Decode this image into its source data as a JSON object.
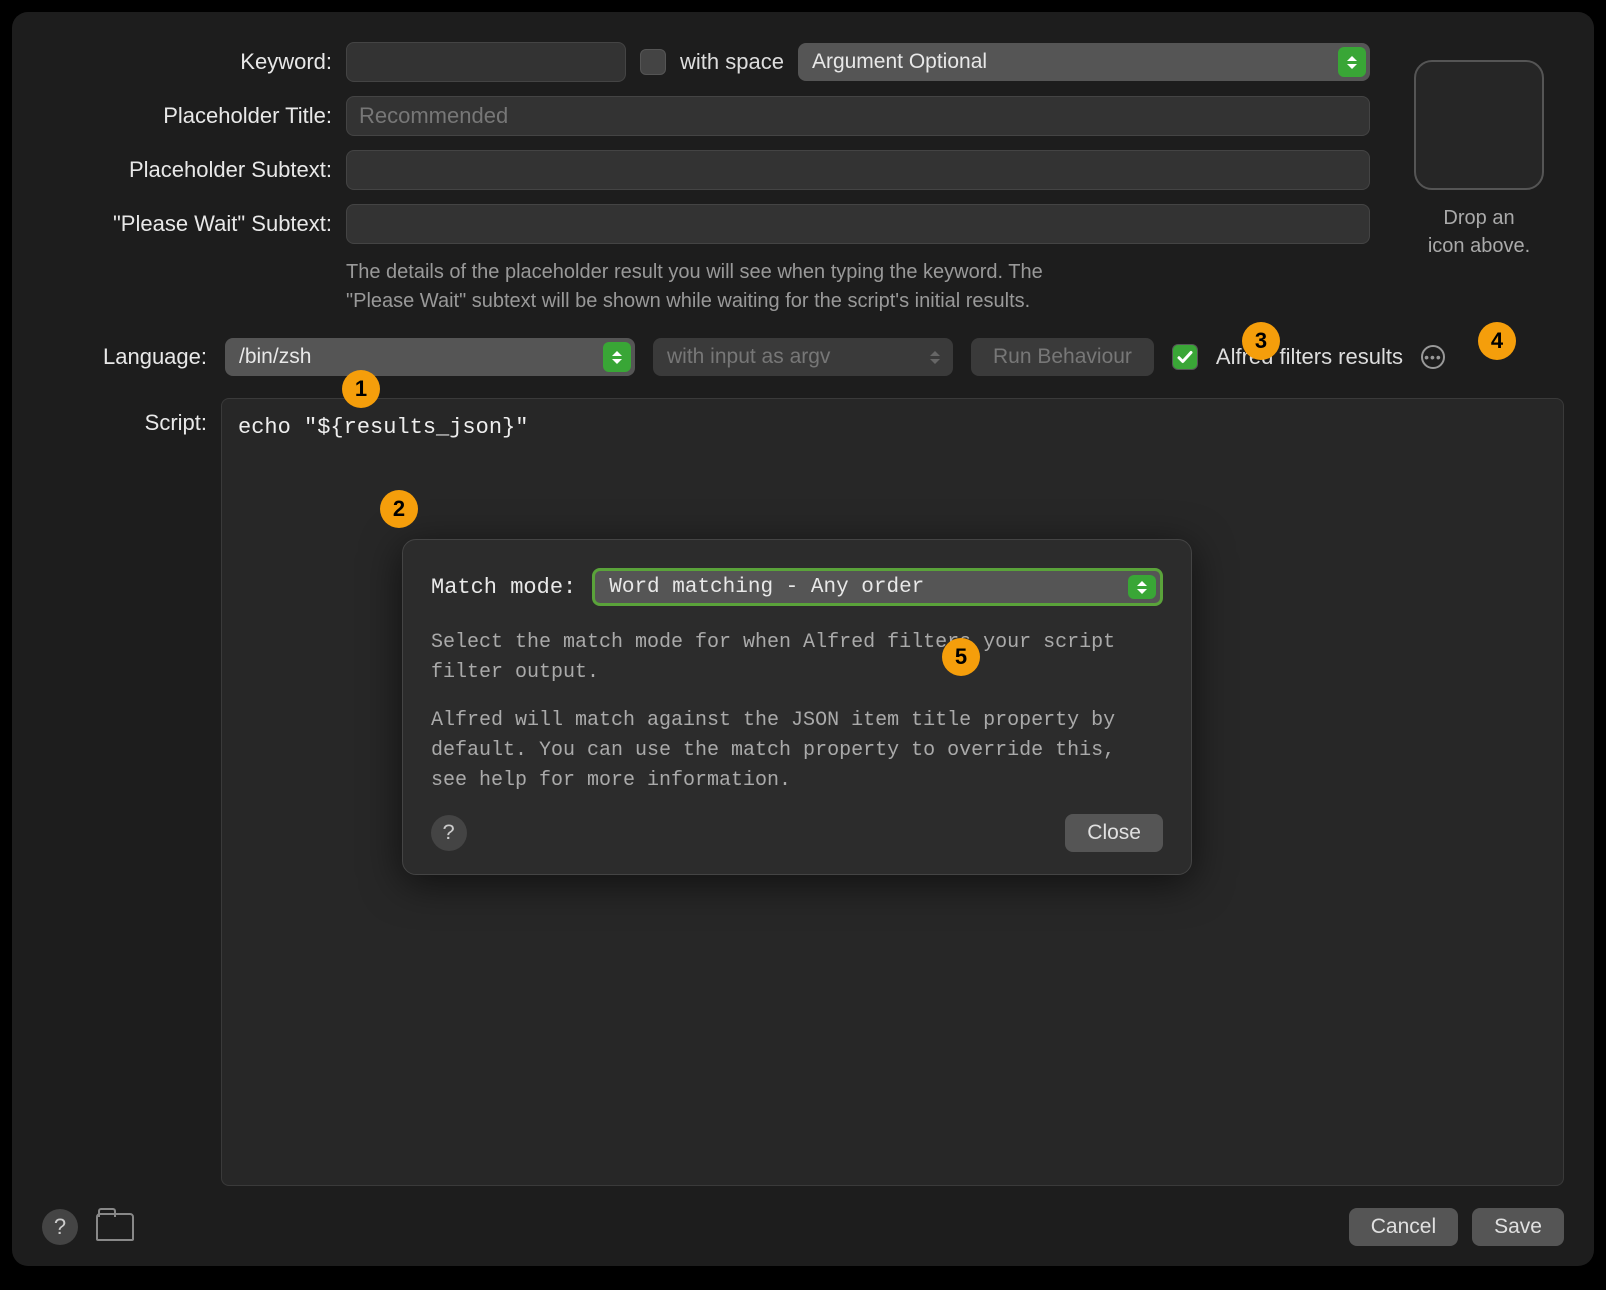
{
  "labels": {
    "keyword": "Keyword:",
    "with_space": "with space",
    "placeholder_title": "Placeholder Title:",
    "placeholder_subtext": "Placeholder Subtext:",
    "please_wait_subtext": "\"Please Wait\" Subtext:",
    "language": "Language:",
    "script": "Script:",
    "drop_icon": "Drop an\nicon above."
  },
  "fields": {
    "keyword_value": "",
    "argument_mode": "Argument Optional",
    "title_placeholder": "Recommended",
    "title_value": "",
    "subtext_value": "",
    "wait_subtext_value": "",
    "language": "/bin/zsh",
    "input_mode": "with input as argv",
    "run_behaviour": "Run Behaviour",
    "filters_label": "Alfred filters results",
    "filters_checked": true,
    "with_space_checked": false
  },
  "helper_text": "The details of the placeholder result you will see when typing the keyword. The \"Please Wait\" subtext will be shown while waiting for the script's initial results.",
  "script_content": "echo \"${results_json}\"",
  "popover": {
    "match_mode_label": "Match mode:",
    "match_mode_value": "Word matching - Any order",
    "desc1": "Select the match mode for when Alfred filters your script filter output.",
    "desc2": "Alfred will match against the JSON item title property by default. You can use the match property to override this, see help for more information.",
    "close": "Close"
  },
  "footer": {
    "cancel": "Cancel",
    "save": "Save"
  },
  "badges": {
    "b1": "1",
    "b2": "2",
    "b3": "3",
    "b4": "4",
    "b5": "5"
  }
}
